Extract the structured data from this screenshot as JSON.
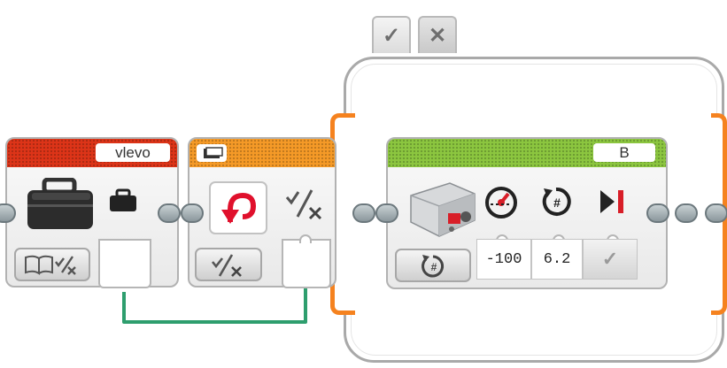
{
  "switch": {
    "tabs": [
      {
        "label": "✓",
        "icon": "check-icon"
      },
      {
        "label": "✕",
        "icon": "close-icon"
      }
    ]
  },
  "blocks": {
    "my_block": {
      "label": "vlevo",
      "color": "#dd3418",
      "mode_icon": "book-logic-icon"
    },
    "loop_interrupt": {
      "color": "#f59a27",
      "mode_icon": "logic-icon"
    },
    "medium_motor": {
      "port": "B",
      "color": "#8cc63f",
      "mode_icon": "rotations-icon",
      "params": [
        {
          "icon": "power-gauge-icon",
          "value": "-100"
        },
        {
          "icon": "rotations-count-icon",
          "value": "6.2"
        },
        {
          "icon": "brake-at-end-icon",
          "value": "✓"
        }
      ]
    }
  },
  "wire_color": "#2e9e6e",
  "rail_color": "#f5821f"
}
